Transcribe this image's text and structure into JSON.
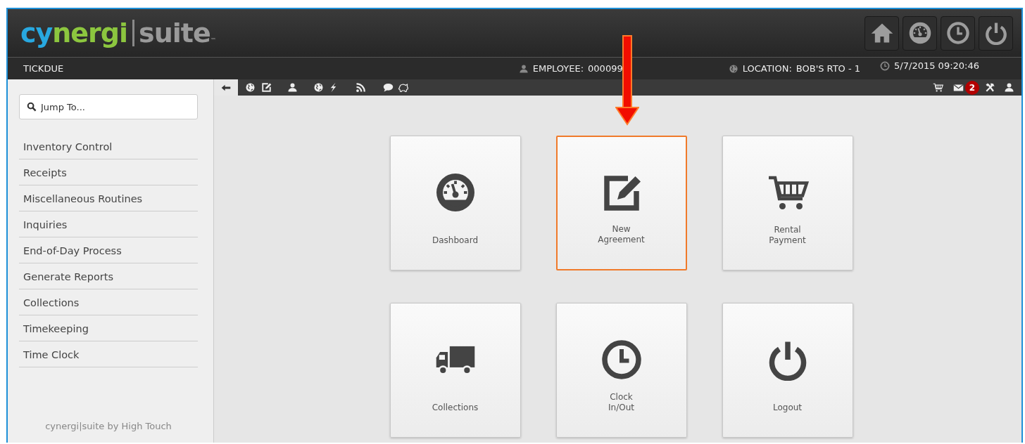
{
  "logo": {
    "brand_start": "cy",
    "brand_end": "nergi",
    "product": "suite",
    "mark": "™"
  },
  "status_bar": {
    "module": "TICKDUE",
    "employee_label": "EMPLOYEE:",
    "employee": "000099",
    "location_label": "LOCATION:",
    "location": "BOB'S RTO - 1",
    "datetime": "5/7/2015 09:20:46"
  },
  "toolbar": {
    "badge": "2"
  },
  "sidebar": {
    "search": {
      "placeholder": "Jump To..."
    },
    "items": [
      "Inventory Control",
      "Receipts",
      "Miscellaneous Routines",
      "Inquiries",
      "End-of-Day Process",
      "Generate Reports",
      "Collections",
      "Timekeeping",
      "Time Clock"
    ],
    "footer": "cynergi|suite by High Touch"
  },
  "tiles": [
    {
      "lines": [
        "Dashboard"
      ],
      "selected": false
    },
    {
      "lines": [
        "New",
        "Agreement"
      ],
      "selected": true
    },
    {
      "lines": [
        "Rental",
        "Payment"
      ],
      "selected": false
    },
    {
      "lines": [
        "Collections"
      ],
      "selected": false
    },
    {
      "lines": [
        "Clock",
        "In/Out"
      ],
      "selected": false
    },
    {
      "lines": [
        "Logout"
      ],
      "selected": false
    }
  ]
}
